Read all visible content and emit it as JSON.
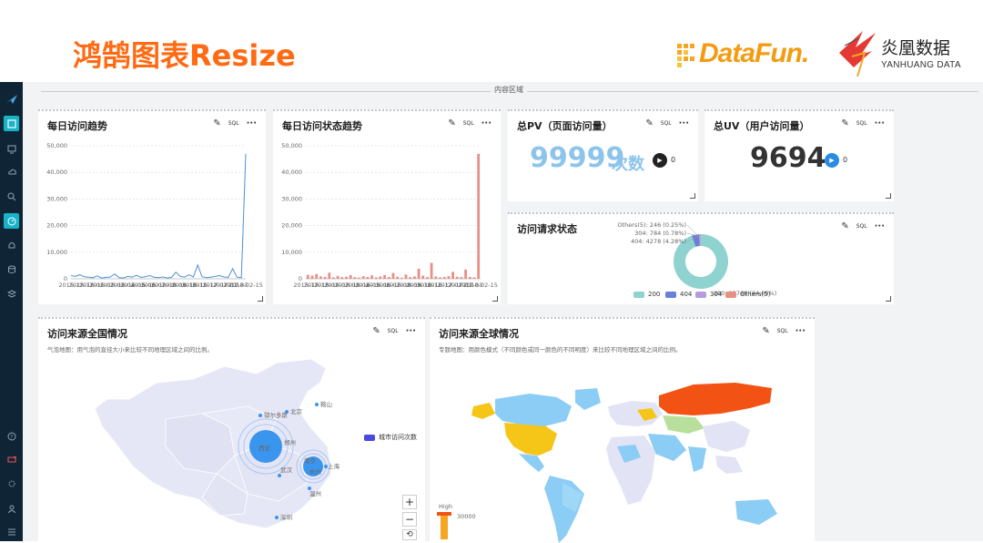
{
  "slide": {
    "title": "鸿鹄图表Resize",
    "logo_datafun": "DataFun.",
    "logo_yh_cn": "炎凰数据",
    "logo_yh_en": "YANHUANG DATA"
  },
  "sidebar": {
    "icons": [
      "logo-bird-icon",
      "dashboard-icon",
      "monitor-icon",
      "cloud-upload-icon",
      "search-icon",
      "speed-icon",
      "bell-icon",
      "database-icon",
      "layers-icon",
      "help-icon",
      "chat-icon",
      "settings-icon",
      "user-icon",
      "list-icon"
    ]
  },
  "content": {
    "region_label": "内容区域"
  },
  "tools": {
    "sql": "SQL",
    "more": "···"
  },
  "cards": {
    "daily_trend": {
      "title": "每日访问趋势",
      "chart_data": {
        "type": "line",
        "color": "#4a90d9",
        "ylim": [
          0,
          50000
        ],
        "yticks": [
          "50,000",
          "40,000",
          "30,000",
          "20,000",
          "10,000",
          "0"
        ],
        "xtick_labels": [
          "2015-12",
          "2015-12",
          "2016-01",
          "2016-02",
          "2016-03",
          "2016-04",
          "2016-05",
          "2016-06",
          "2016-07",
          "2016-08",
          "2016-09",
          "2016-10",
          "2016-11",
          "2016-12",
          "2017-01",
          "2017-02",
          "2017-03",
          "2018-02-15"
        ],
        "values": [
          1200,
          900,
          1500,
          800,
          600,
          400,
          1100,
          300,
          500,
          700,
          1800,
          400,
          300,
          900,
          600,
          1300,
          500,
          800,
          1200,
          600,
          400,
          700,
          300,
          500,
          2500,
          900,
          600,
          1500,
          700,
          5200,
          800,
          400,
          600,
          900,
          1200,
          700,
          500,
          3800,
          600,
          400,
          47000
        ]
      }
    },
    "daily_status": {
      "title": "每日访问状态趋势",
      "chart_data": {
        "type": "bar",
        "color": "#e88f86",
        "ylim": [
          0,
          50000
        ],
        "yticks": [
          "50,000",
          "40,000",
          "30,000",
          "20,000",
          "10,000",
          "0"
        ],
        "xtick_labels": [
          "2015-12",
          "2015-12",
          "2016-01",
          "2016-02",
          "2016-03",
          "2016-04",
          "2016-05",
          "2016-06",
          "2016-07",
          "2016-08",
          "2016-09",
          "2016-10",
          "2016-11",
          "2016-12",
          "2017-01",
          "2017-02",
          "2017-03",
          "2018-02-15"
        ],
        "values": [
          1500,
          1200,
          1800,
          900,
          700,
          2300,
          500,
          1100,
          600,
          800,
          1400,
          600,
          400,
          1000,
          700,
          1300,
          500,
          900,
          1400,
          700,
          2200,
          800,
          400,
          1600,
          600,
          900,
          3800,
          1200,
          600,
          6000,
          900,
          500,
          700,
          1000,
          2600,
          800,
          600,
          3500,
          700,
          500,
          47000
        ]
      }
    },
    "total_pv": {
      "title": "总PV（页面访问量）",
      "value": "99999",
      "unit": "次数",
      "delta": "0",
      "color": "#8dc4ec"
    },
    "total_uv": {
      "title": "总UV（用户访问量）",
      "value": "9694",
      "delta": "0",
      "color": "#333333"
    },
    "request_status": {
      "title": "访问请求状态",
      "chart_data": {
        "type": "pie",
        "series": [
          {
            "name": "200",
            "value": 93740,
            "color": "#8fd3d0"
          },
          {
            "name": "404",
            "value": 4278,
            "color": "#6a7fd6"
          },
          {
            "name": "304",
            "value": 784,
            "color": "#b79adf"
          },
          {
            "name": "Others(5)",
            "value": 246,
            "color": "#e88f86"
          }
        ],
        "labels": [
          "Others(5): 246 (0.25%)",
          "304: 784 (0.78%)",
          "404: 4278 (4.28%)"
        ],
        "overlap_label": "200: 93740 (94.69%)"
      },
      "legend": [
        "200",
        "404",
        "304",
        "Others(5)"
      ]
    },
    "china_map": {
      "title": "访问来源全国情况",
      "subtitle": "气泡地图：用气泡的直径大小来比较不同地理区域之间的比例。",
      "legend_label": "城市访问次数",
      "cities": [
        {
          "name": "鞍山"
        },
        {
          "name": "北京"
        },
        {
          "name": "鄂尔多斯"
        },
        {
          "name": "西安"
        },
        {
          "name": "郑州"
        },
        {
          "name": "武汉"
        },
        {
          "name": "南京"
        },
        {
          "name": "上海"
        },
        {
          "name": "杭州"
        },
        {
          "name": "温州"
        },
        {
          "name": "深圳"
        }
      ]
    },
    "world_map": {
      "title": "访问来源全球情况",
      "subtitle": "专题地图：用颜色模式（不同颜色或同一颜色的不同明度）来比较不同地理区域之间的比例。",
      "legend_high": "High",
      "legend_value": "30000"
    }
  }
}
